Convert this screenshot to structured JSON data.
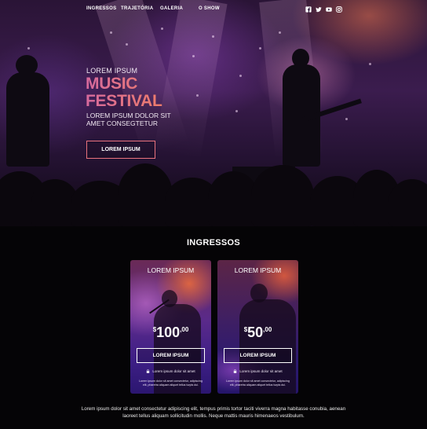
{
  "nav": {
    "items": [
      "INGRESSOS",
      "TRAJETÓRIA",
      "GALERIA",
      "O SHOW"
    ],
    "social_icons": [
      "facebook-icon",
      "twitter-icon",
      "youtube-icon",
      "instagram-icon"
    ]
  },
  "hero": {
    "kicker": "LOREM IPSUM",
    "title_line1": "MUSIC",
    "title_line2": "FESTIVAL",
    "subtitle": "LOREM IPSUM DOLOR SIT AMET CONSEGTETUR",
    "button_label": "LOREM IPSUM"
  },
  "tickets": {
    "heading": "INGRESSOS",
    "cards": [
      {
        "title": "LOREM IPSUM",
        "currency": "$",
        "amount": "100",
        "cents": ",00",
        "button_label": "LOREM IPSUM",
        "note": "Lorem ipsum dolor sit amet",
        "fine_print": "Lorem ipsum dolor sit amet consectetur, adipiscing elit, pharetra aliquam aliquet tellus turpis dui."
      },
      {
        "title": "LOREM IPSUM",
        "currency": "$",
        "amount": "50",
        "cents": ",00",
        "button_label": "LOREM IPSUM",
        "note": "Lorem ipsum dolor sit amet",
        "fine_print": "Lorem ipsum dolor sit amet consectetur, adipiscing elit, pharetra aliquam aliquet tellus turpis dui."
      }
    ]
  },
  "footer": {
    "text": "Lorem ipsum dolor sit amet consectetur adipiscing elit, tempus primis tortor taciti viverra magna habitasse conubia, aenean laoreet tellus aliquam sollicitudin mollis. Neque mattis mauris himenaeos vestibulum."
  },
  "colors": {
    "accent_gradient_start": "#d76a9e",
    "accent_gradient_end": "#ee7d6a",
    "hero_button_border": "#e9737d",
    "page_background": "#050406"
  }
}
